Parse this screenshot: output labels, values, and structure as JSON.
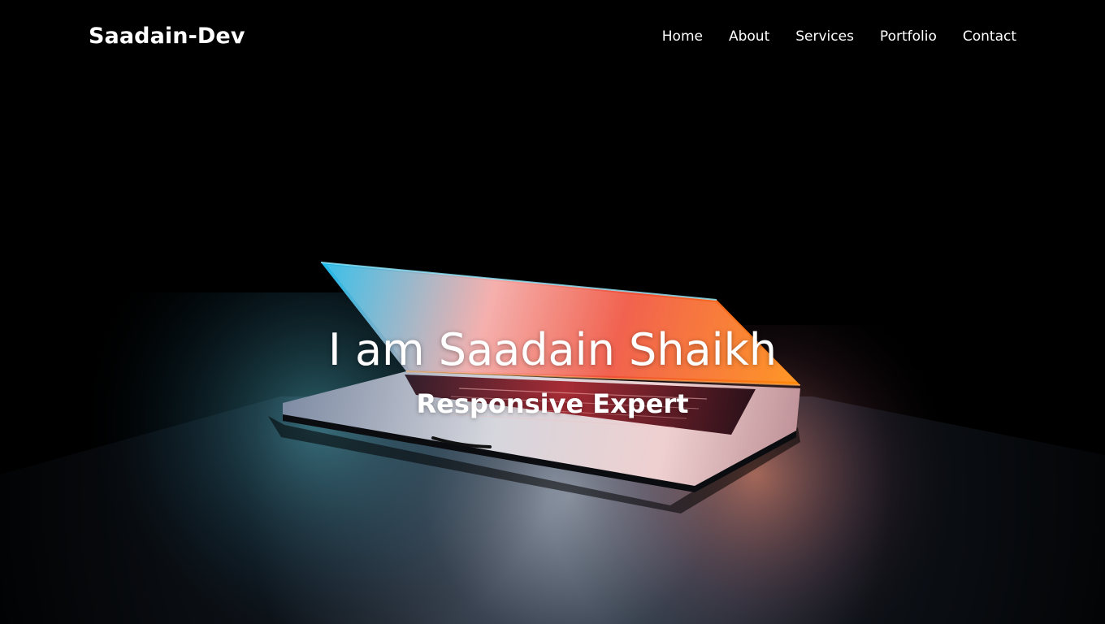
{
  "brand": {
    "logo_text": "Saadain-Dev"
  },
  "nav": {
    "items": [
      {
        "label": "Home"
      },
      {
        "label": "About"
      },
      {
        "label": "Services"
      },
      {
        "label": "Portfolio"
      },
      {
        "label": "Contact"
      }
    ]
  },
  "hero": {
    "title": "I am Saadain Shaikh",
    "subtitle": "Responsive Expert",
    "background_image": "laptop-glow-photo"
  },
  "colors": {
    "text": "#ffffff",
    "background": "#000000"
  }
}
